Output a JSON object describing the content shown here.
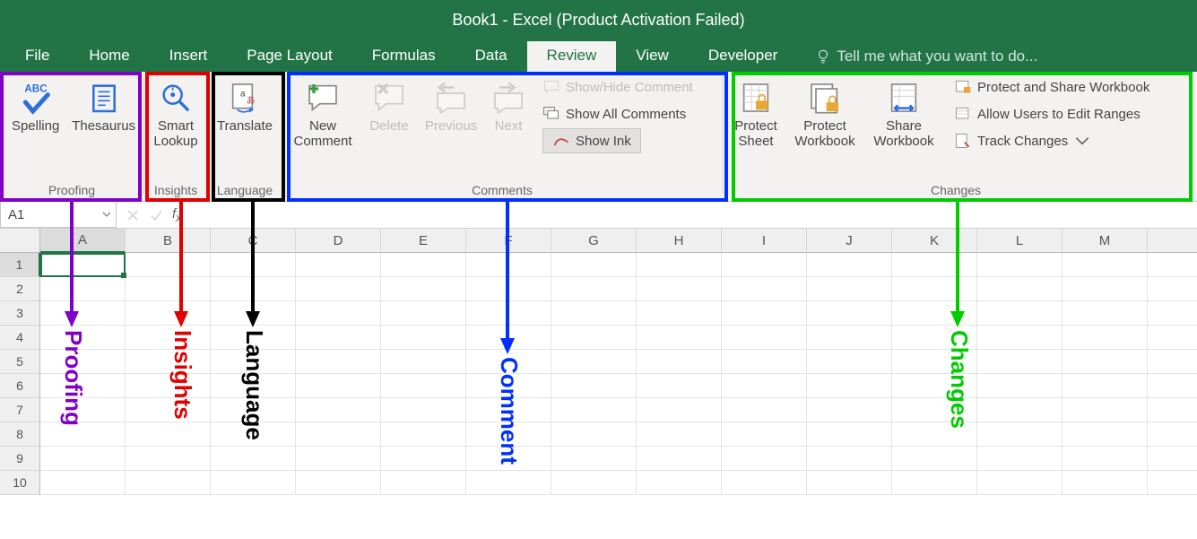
{
  "title": "Book1 - Excel (Product Activation Failed)",
  "tabs": {
    "file": "File",
    "home": "Home",
    "insert": "Insert",
    "pagelayout": "Page Layout",
    "formulas": "Formulas",
    "data": "Data",
    "review": "Review",
    "view": "View",
    "developer": "Developer"
  },
  "tellme": "Tell me what you want to do...",
  "ribbon": {
    "proofing": {
      "label": "Proofing",
      "spelling": "Spelling",
      "thesaurus": "Thesaurus",
      "abc": "ABC"
    },
    "insights": {
      "label": "Insights",
      "smartlookup1": "Smart",
      "smartlookup2": "Lookup"
    },
    "language": {
      "label": "Language",
      "translate": "Translate"
    },
    "comments": {
      "label": "Comments",
      "new1": "New",
      "new2": "Comment",
      "delete": "Delete",
      "previous": "Previous",
      "next": "Next",
      "showhide": "Show/Hide Comment",
      "showall": "Show All Comments",
      "showink": "Show Ink"
    },
    "changes": {
      "label": "Changes",
      "protectsheet1": "Protect",
      "protectsheet2": "Sheet",
      "protectwb1": "Protect",
      "protectwb2": "Workbook",
      "sharewb1": "Share",
      "sharewb2": "Workbook",
      "protectshare": "Protect and Share Workbook",
      "allowedit": "Allow Users to Edit Ranges",
      "track": "Track Changes"
    }
  },
  "namebox": "A1",
  "columns": [
    "A",
    "B",
    "C",
    "D",
    "E",
    "F",
    "G",
    "H",
    "I",
    "J",
    "K",
    "L",
    "M"
  ],
  "rows": [
    "1",
    "2",
    "3",
    "4",
    "5",
    "6",
    "7",
    "8",
    "9",
    "10"
  ],
  "annotations": {
    "proofing": "Proofing",
    "insights": "Insights",
    "language": "Language",
    "comment": "Comment",
    "changes": "Changes"
  }
}
